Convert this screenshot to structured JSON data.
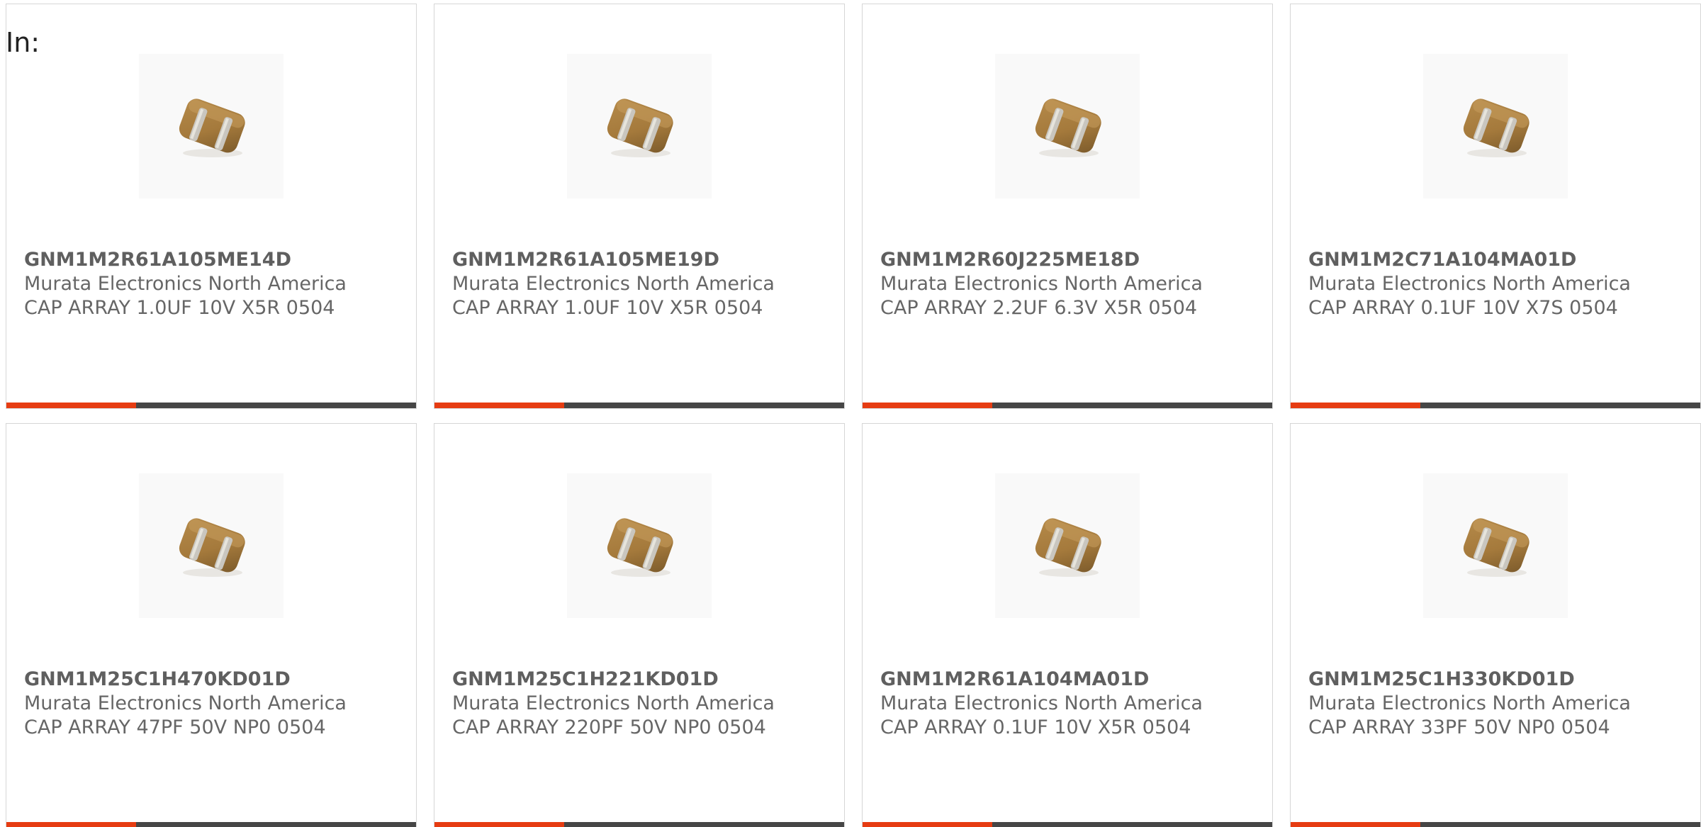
{
  "header": {
    "label": "In:"
  },
  "colors": {
    "accent": "#e63c12",
    "bar_dark": "#464646",
    "body_tan": "#a57a3c",
    "terminal_grey": "#c9c6bf"
  },
  "products": [
    {
      "part_number": "GNM1M2R61A105ME14D",
      "manufacturer": "Murata Electronics North America",
      "description": "CAP ARRAY 1.0UF 10V X5R 0504",
      "image_icon": "capacitor-array-icon"
    },
    {
      "part_number": "GNM1M2R61A105ME19D",
      "manufacturer": "Murata Electronics North America",
      "description": "CAP ARRAY 1.0UF 10V X5R 0504",
      "image_icon": "capacitor-array-icon"
    },
    {
      "part_number": "GNM1M2R60J225ME18D",
      "manufacturer": "Murata Electronics North America",
      "description": "CAP ARRAY 2.2UF 6.3V X5R 0504",
      "image_icon": "capacitor-array-icon"
    },
    {
      "part_number": "GNM1M2C71A104MA01D",
      "manufacturer": "Murata Electronics North America",
      "description": "CAP ARRAY 0.1UF 10V X7S 0504",
      "image_icon": "capacitor-array-icon"
    },
    {
      "part_number": "GNM1M25C1H470KD01D",
      "manufacturer": "Murata Electronics North America",
      "description": "CAP ARRAY 47PF 50V NP0 0504",
      "image_icon": "capacitor-array-icon"
    },
    {
      "part_number": "GNM1M25C1H221KD01D",
      "manufacturer": "Murata Electronics North America",
      "description": "CAP ARRAY 220PF 50V NP0 0504",
      "image_icon": "capacitor-array-icon"
    },
    {
      "part_number": "GNM1M2R61A104MA01D",
      "manufacturer": "Murata Electronics North America",
      "description": "CAP ARRAY 0.1UF 10V X5R 0504",
      "image_icon": "capacitor-array-icon"
    },
    {
      "part_number": "GNM1M25C1H330KD01D",
      "manufacturer": "Murata Electronics North America",
      "description": "CAP ARRAY 33PF 50V NP0 0504",
      "image_icon": "capacitor-array-icon"
    }
  ]
}
